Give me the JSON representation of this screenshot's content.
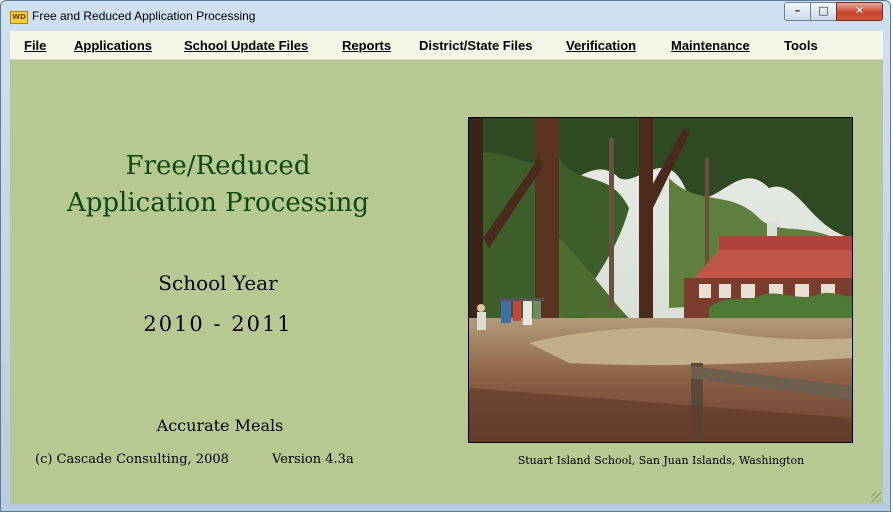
{
  "window": {
    "title": "Free and Reduced Application Processing",
    "icon_name": "wd-app-icon",
    "controls": {
      "minimize": "–",
      "maximize": "□",
      "close": "✕"
    }
  },
  "menu": {
    "items": [
      {
        "label": "File"
      },
      {
        "label": "Applications"
      },
      {
        "label": "School Update Files"
      },
      {
        "label": "Reports"
      },
      {
        "label": "District/State Files"
      },
      {
        "label": "Verification"
      },
      {
        "label": "Maintenance"
      },
      {
        "label": "Tools"
      }
    ]
  },
  "main": {
    "heading_line1": "Free/Reduced",
    "heading_line2": "Application Processing",
    "school_year_label": "School Year",
    "school_year_value": "2010  -  2011",
    "product": "Accurate Meals",
    "copyright": "(c) Cascade Consulting, 2008",
    "version": "Version 4.3a",
    "photo_caption": "Stuart Island School, San Juan Islands, Washington"
  },
  "colors": {
    "background": "#b8c893",
    "heading": "#0b4a12",
    "menubar": "#f5f6e6"
  }
}
